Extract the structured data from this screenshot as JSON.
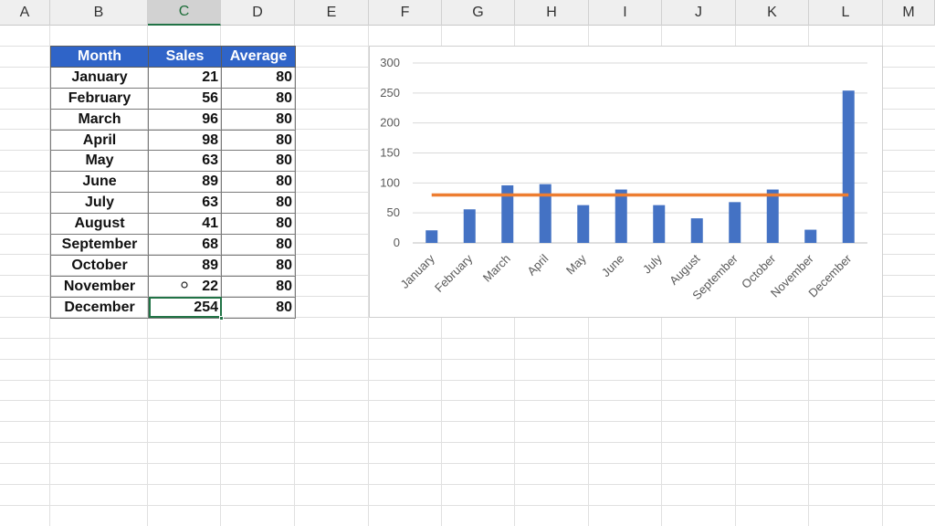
{
  "sheet": {
    "columns": [
      "A",
      "B",
      "C",
      "D",
      "E",
      "F",
      "G",
      "H",
      "I",
      "J",
      "K",
      "L",
      "M"
    ],
    "selected_column": "C",
    "colors": {
      "header_bg": "#efefef",
      "selected_accent": "#217346",
      "table_header_bg": "#2f64c8"
    }
  },
  "table": {
    "headers": {
      "month": "Month",
      "sales": "Sales",
      "average": "Average"
    },
    "rows": [
      {
        "month": "January",
        "sales": "21",
        "average": "80"
      },
      {
        "month": "February",
        "sales": "56",
        "average": "80"
      },
      {
        "month": "March",
        "sales": "96",
        "average": "80"
      },
      {
        "month": "April",
        "sales": "98",
        "average": "80"
      },
      {
        "month": "May",
        "sales": "63",
        "average": "80"
      },
      {
        "month": "June",
        "sales": "89",
        "average": "80"
      },
      {
        "month": "July",
        "sales": "63",
        "average": "80"
      },
      {
        "month": "August",
        "sales": "41",
        "average": "80"
      },
      {
        "month": "September",
        "sales": "68",
        "average": "80"
      },
      {
        "month": "October",
        "sales": "89",
        "average": "80"
      },
      {
        "month": "November",
        "sales": "22",
        "average": "80"
      },
      {
        "month": "December",
        "sales": "254",
        "average": "80"
      }
    ],
    "active_cell": "December-sales"
  },
  "chart_data": {
    "type": "bar",
    "categories": [
      "January",
      "February",
      "March",
      "April",
      "May",
      "June",
      "July",
      "August",
      "September",
      "October",
      "November",
      "December"
    ],
    "series": [
      {
        "values": [
          21,
          56,
          96,
          98,
          63,
          89,
          63,
          41,
          68,
          89,
          22,
          254
        ],
        "color": "#4472c4",
        "render": "bar"
      },
      {
        "values": [
          80,
          80,
          80,
          80,
          80,
          80,
          80,
          80,
          80,
          80,
          80,
          80
        ],
        "color": "#ed7d31",
        "render": "line"
      }
    ],
    "title": "",
    "xlabel": "",
    "ylabel": "",
    "ylim": [
      0,
      300
    ],
    "yticks": [
      0,
      50,
      100,
      150,
      200,
      250,
      300
    ],
    "grid": true,
    "legend": "none"
  }
}
